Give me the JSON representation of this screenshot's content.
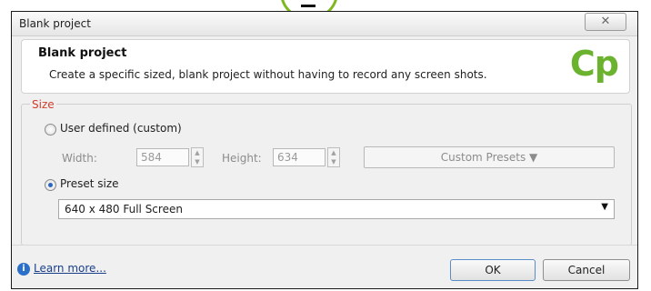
{
  "window": {
    "title": "Blank project",
    "close_glyph": "✕"
  },
  "header": {
    "title": "Blank project",
    "description": "Create a specific sized, blank project without having to record any screen shots.",
    "logo": "Cp"
  },
  "size": {
    "legend": "Size",
    "user_defined_label": "User defined (custom)",
    "width_label": "Width:",
    "width_value": "584",
    "height_label": "Height:",
    "height_value": "634",
    "presets_button": "Custom Presets ▼",
    "preset_label": "Preset size",
    "preset_selected": "640 x 480 Full Screen",
    "user_defined_checked": false,
    "preset_checked": true
  },
  "footer": {
    "learn_more": "Learn more...",
    "ok": "OK",
    "cancel": "Cancel"
  },
  "colors": {
    "accent": "#6bb32f",
    "legend": "#d23c2a",
    "link": "#1a3f8a"
  },
  "icons": {
    "info": "info-icon",
    "close": "close-icon"
  }
}
